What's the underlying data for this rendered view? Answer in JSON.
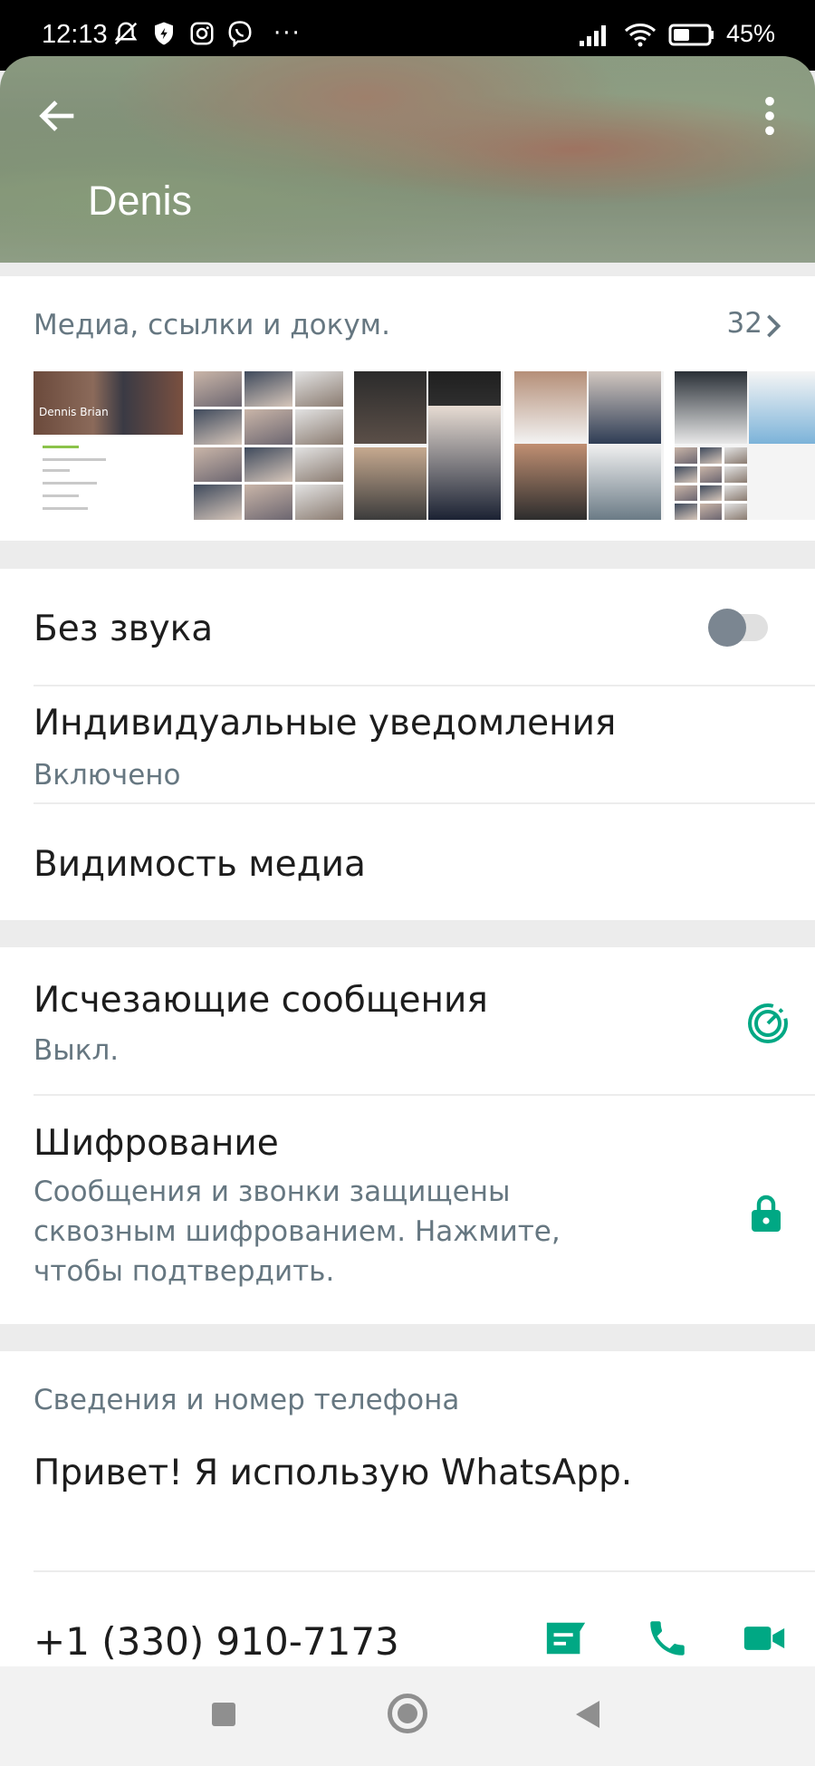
{
  "status_bar": {
    "time": "12:13",
    "battery": "45%",
    "more": "···",
    "icons_left": [
      "mute-bell-icon",
      "shield-icon",
      "instagram-icon",
      "viber-icon"
    ],
    "icons_right": [
      "signal-icon",
      "wifi-icon",
      "battery-icon"
    ]
  },
  "header": {
    "contact_name": "Denis",
    "back_icon": "arrow-left-icon",
    "menu_icon": "more-vert-icon"
  },
  "media": {
    "title": "Медиа, ссылки и докум.",
    "count": "32",
    "thumb_1_label": "Dennis Brian"
  },
  "settings": {
    "mute_label": "Без звука",
    "mute_on": false,
    "custom_notifications_label": "Индивидуальные уведомления",
    "custom_notifications_value": "Включено",
    "media_visibility_label": "Видимость медиа"
  },
  "privacy": {
    "disappearing_label": "Исчезающие сообщения",
    "disappearing_value": "Выкл.",
    "encryption_label": "Шифрование",
    "encryption_line1": "Сообщения и звонки защищены",
    "encryption_line2": "сквозным шифрованием. Нажмите,",
    "encryption_line3": "чтобы подтвердить."
  },
  "about": {
    "section_title": "Сведения и номер телефона",
    "status_text": "Привет! Я использую WhatsApp.",
    "phone": "+1 (330) 910-7173"
  },
  "colors": {
    "accent": "#00a884",
    "secondary_text": "#667781"
  }
}
